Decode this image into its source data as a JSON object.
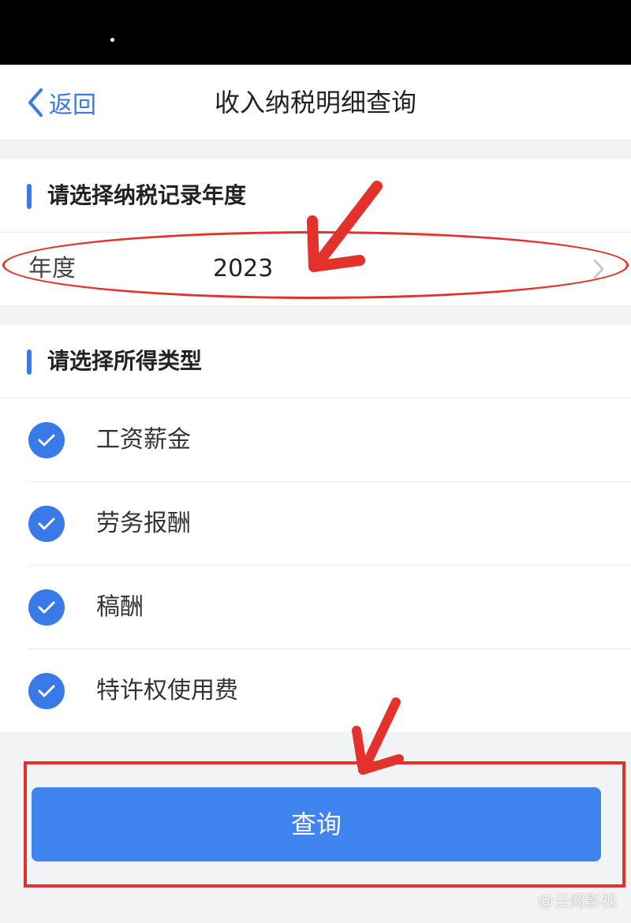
{
  "nav": {
    "back_label": "返回",
    "title": "收入纳税明细查询"
  },
  "year_section": {
    "title": "请选择纳税记录年度",
    "year_label": "年度",
    "year_value": "2023"
  },
  "type_section": {
    "title": "请选择所得类型",
    "items": [
      {
        "label": "工资薪金",
        "checked": true
      },
      {
        "label": "劳务报酬",
        "checked": true
      },
      {
        "label": "稿酬",
        "checked": true
      },
      {
        "label": "特许权使用费",
        "checked": true
      }
    ]
  },
  "query_button": {
    "label": "查询"
  },
  "watermark": {
    "text": "@云阙影视"
  },
  "colors": {
    "accent": "#3a7ae8",
    "button": "#3f84ef",
    "annotation": "#e3322b"
  }
}
